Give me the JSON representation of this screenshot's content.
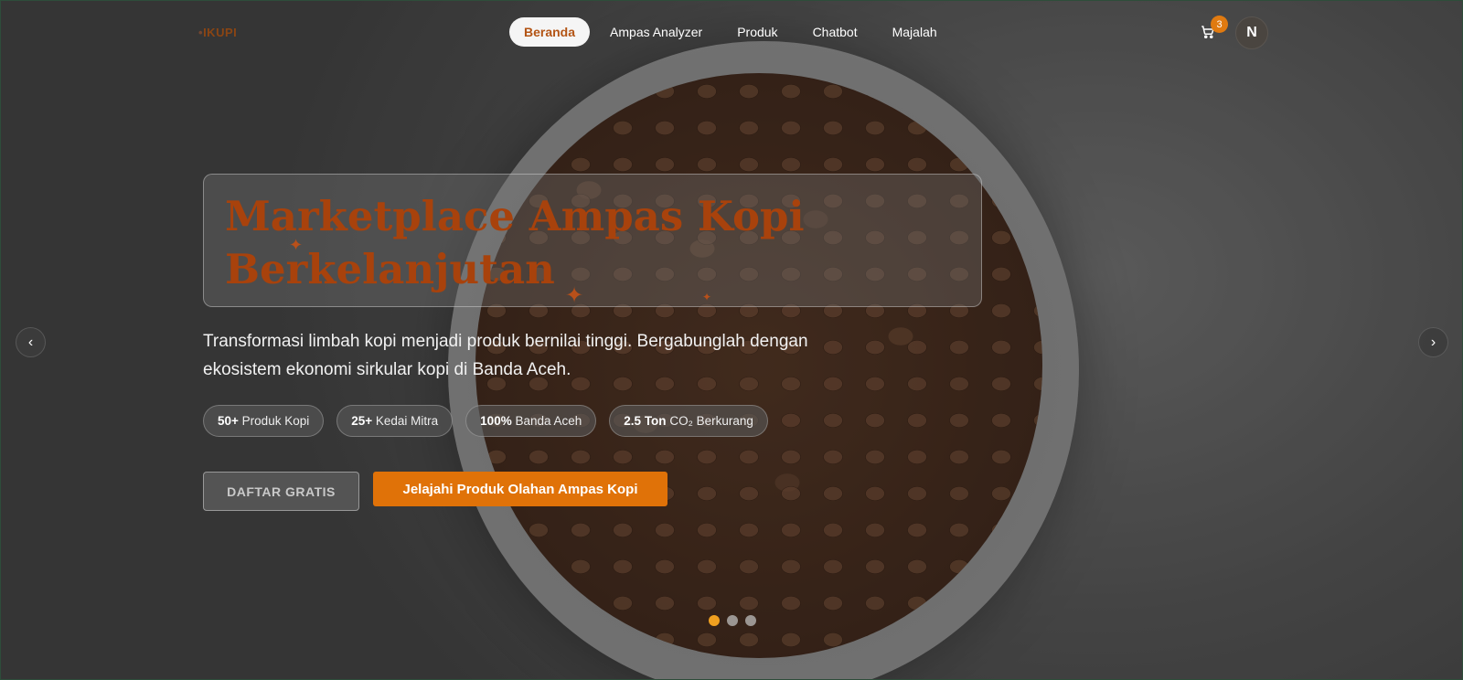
{
  "brand": {
    "logo": "IKUPI"
  },
  "nav": {
    "items": [
      {
        "label": "Beranda",
        "active": true
      },
      {
        "label": "Ampas Analyzer"
      },
      {
        "label": "Produk"
      },
      {
        "label": "Chatbot"
      },
      {
        "label": "Majalah"
      }
    ]
  },
  "header": {
    "cart_count": "3",
    "avatar_initial": "N"
  },
  "hero": {
    "title_line1": "Marketplace Ampas Kopi",
    "title_line2": "Berkelanjutan",
    "description": "Transformasi limbah kopi menjadi produk bernilai tinggi. Bergabunglah dengan ekosistem ekonomi sirkular kopi di Banda Aceh.",
    "stats": [
      {
        "value": "50+",
        "label": "Produk Kopi"
      },
      {
        "value": "25+",
        "label": "Kedai Mitra"
      },
      {
        "value": "100%",
        "label": "Banda Aceh"
      },
      {
        "value": "2.5 Ton",
        "label": "CO₂ Berkurang"
      }
    ],
    "cta_secondary": "DAFTAR GRATIS",
    "cta_primary": "Jelajahi Produk Olahan Ampas Kopi"
  },
  "carousel": {
    "prev_icon": "chevron-left-icon",
    "next_icon": "chevron-right-icon",
    "slides": 3,
    "active_index": 0
  },
  "colors": {
    "accent": "#e07208",
    "title": "#a8420c",
    "active_dot": "#f0a020"
  }
}
